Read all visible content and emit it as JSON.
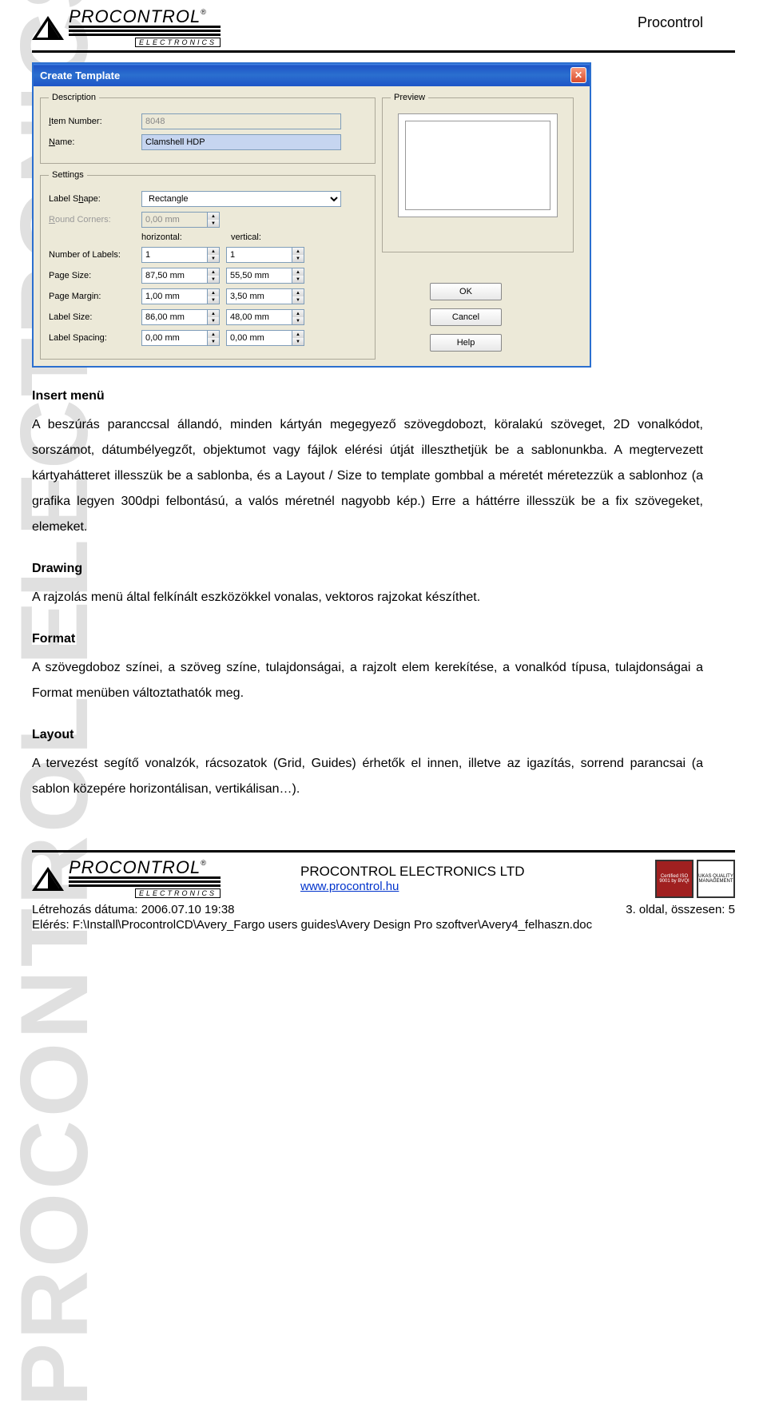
{
  "header": {
    "brand": "PROCONTROL",
    "sub": "ELECTRONICS",
    "right": "Procontrol"
  },
  "watermark": "PROCONTROL ELECTRONICS LTD.",
  "dialog": {
    "title": "Create Template",
    "description": {
      "legend": "Description",
      "item_label": "Item Number:",
      "item_value": "8048",
      "name_label": "Name:",
      "name_value": "Clamshell HDP"
    },
    "settings": {
      "legend": "Settings",
      "shape_label": "Label Shape:",
      "shape_value": "Rectangle",
      "corners_label": "Round Corners:",
      "corners_value": "0,00 mm",
      "axis_h": "horizontal:",
      "axis_v": "vertical:",
      "numlabels_label": "Number of Labels:",
      "numlabels_h": "1",
      "numlabels_v": "1",
      "pagesize_label": "Page Size:",
      "pagesize_h": "87,50 mm",
      "pagesize_v": "55,50 mm",
      "pagemargin_label": "Page Margin:",
      "pagemargin_h": "1,00 mm",
      "pagemargin_v": "3,50 mm",
      "labelsize_label": "Label Size:",
      "labelsize_h": "86,00 mm",
      "labelsize_v": "48,00 mm",
      "labelspacing_label": "Label Spacing:",
      "labelspacing_h": "0,00 mm",
      "labelspacing_v": "0,00 mm"
    },
    "preview_legend": "Preview",
    "buttons": {
      "ok": "OK",
      "cancel": "Cancel",
      "help": "Help"
    }
  },
  "sections": {
    "insert_heading": "Insert menü",
    "insert_body": "A beszúrás paranccsal állandó, minden kártyán megegyező szövegdobozt, köralakú szöveget, 2D vonalkódot, sorszámot, dátumbélyegzőt, objektumot vagy fájlok elérési útját illeszthetjük be a sablonunkba. A megtervezett kártyahátteret illesszük be a sablonba, és a Layout / Size to template gombbal a méretét méretezzük a sablonhoz (a grafika legyen 300dpi felbontású, a valós méretnél nagyobb kép.) Erre a háttérre illesszük be a fix szövegeket, elemeket.",
    "drawing_heading": "Drawing",
    "drawing_body": "A rajzolás menü által felkínált eszközökkel vonalas, vektoros rajzokat készíthet.",
    "format_heading": "Format",
    "format_body": "A szövegdoboz színei, a szöveg színe, tulajdonságai, a rajzolt elem kerekítése, a vonalkód típusa, tulajdonságai a Format menüben változtathatók meg.",
    "layout_heading": "Layout",
    "layout_body": "A tervezést segítő vonalzók, rácsozatok (Grid, Guides) érhetők el innen, illetve az igazítás, sorrend parancsai (a sablon közepére horizontálisan, vertikálisan…)."
  },
  "footer": {
    "company": "PROCONTROL ELECTRONICS LTD",
    "url": "www.procontrol.hu",
    "created": "Létrehozás dátuma: 2006.07.10 19:38",
    "page": "3. oldal, összesen: 5",
    "path": "Elérés: F:\\Install\\ProcontrolCD\\Avery_Fargo users guides\\Avery Design Pro szoftver\\Avery4_felhaszn.doc",
    "cert1": "Certified ISO 9001 by BVQI",
    "cert2": "UKAS QUALITY MANAGEMENT"
  }
}
